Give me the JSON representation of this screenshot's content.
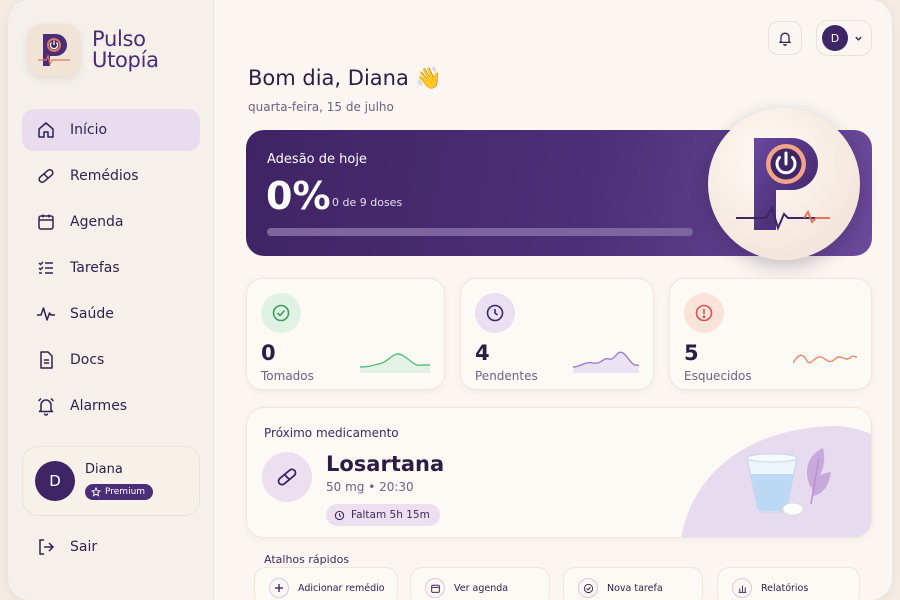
{
  "brand": {
    "line1": "Pulso",
    "line2": "Utopía"
  },
  "nav": {
    "items": [
      {
        "label": "Início",
        "icon": "home-icon",
        "active": true
      },
      {
        "label": "Remédios",
        "icon": "pill-icon"
      },
      {
        "label": "Agenda",
        "icon": "calendar-icon"
      },
      {
        "label": "Tarefas",
        "icon": "tasks-icon"
      },
      {
        "label": "Saúde",
        "icon": "pulse-icon"
      },
      {
        "label": "Docs",
        "icon": "document-icon"
      },
      {
        "label": "Alarmes",
        "icon": "alarm-icon"
      }
    ]
  },
  "user": {
    "initial": "D",
    "name": "Diana",
    "plan": "Premium"
  },
  "logout": {
    "label": "Sair"
  },
  "header": {
    "avatar_initial": "D"
  },
  "greeting": {
    "text": "Bom dia, Diana 👋",
    "date": "quarta-feira, 15 de julho"
  },
  "adherence": {
    "title": "Adesão de hoje",
    "percent_text": "0%",
    "progress": 0,
    "doses": "0 de 9 doses"
  },
  "stats": [
    {
      "value": "0",
      "label": "Tomados",
      "icon": "check-circle-icon",
      "color": "#5bbf7a"
    },
    {
      "value": "4",
      "label": "Pendentes",
      "icon": "clock-icon",
      "color": "#8b6fc0"
    },
    {
      "value": "5",
      "label": "Esquecidos",
      "icon": "alert-circle-icon",
      "color": "#e07b5f"
    }
  ],
  "next_med": {
    "title": "Próximo medicamento",
    "name": "Losartana",
    "dose": "50 mg • 20:30",
    "time_left": "Faltam 5h 15m"
  },
  "shortcuts": {
    "title": "Atalhos rápidos",
    "items": [
      {
        "label": "Adicionar remédio",
        "icon": "plus-icon"
      },
      {
        "label": "Ver agenda",
        "icon": "calendar-icon"
      },
      {
        "label": "Nova tarefa",
        "icon": "check-circle-icon"
      },
      {
        "label": "Relatórios",
        "icon": "bar-chart-icon"
      }
    ]
  },
  "colors": {
    "primary": "#4b2d78",
    "accent": "#e07b5f",
    "background": "#fbf6f1"
  }
}
